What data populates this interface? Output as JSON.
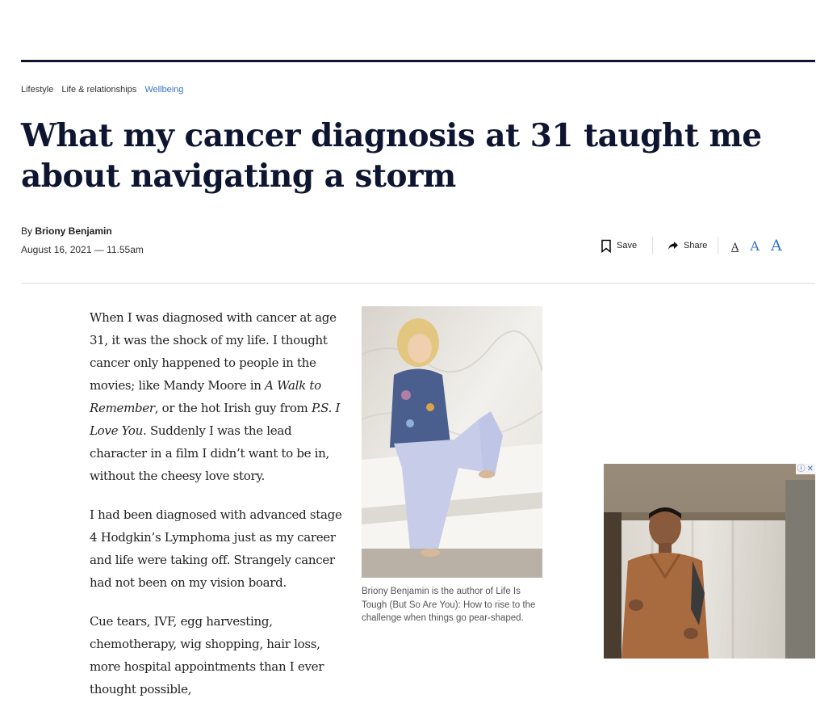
{
  "breadcrumb": [
    "Lifestyle",
    "Life & relationships",
    "Wellbeing"
  ],
  "headline": "What my cancer diagnosis at 31 taught me about navigating a storm",
  "byline": {
    "prefix": "By ",
    "author": "Briony Benjamin"
  },
  "date": "August 16, 2021 — 11.55am",
  "toolbar": {
    "save_label": "Save",
    "share_label": "Share",
    "font_sizes": [
      "A",
      "A",
      "A"
    ]
  },
  "icons": {
    "save": "bookmark-icon",
    "share": "share-arrow-icon",
    "ad_info": "info-icon",
    "ad_close": "close-icon"
  },
  "colors": {
    "headline": "#0e1530",
    "link": "#3a74c4",
    "rule": "#0f1530"
  },
  "article": {
    "p1": {
      "t1": "When I was diagnosed with cancer at age 31, it was the shock of my life. I thought cancer only happened to people in the movies; like Mandy Moore in ",
      "i1": "A Walk to Remember",
      "t2": ", or the hot Irish guy from ",
      "i2": "P.S. I Love You",
      "t3": ". Suddenly I was the lead character in a film I didn’t want to be in, without the cheesy love story."
    },
    "p2": "I had been diagnosed with advanced stage 4 Hodgkin’s Lymphoma just as my career and life were taking off. Strangely cancer had not been on my vision board.",
    "p3": "Cue tears, IVF, egg harvesting, chemotherapy, wig shopping, hair loss, more hospital appointments than I ever thought possible,"
  },
  "image": {
    "caption": "Briony Benjamin is the author of Life Is Tough (But So Are You): How to rise to the challenge when things go pear-shaped."
  },
  "ad": {
    "badge_info": "ⓘ",
    "badge_close": "✕"
  }
}
